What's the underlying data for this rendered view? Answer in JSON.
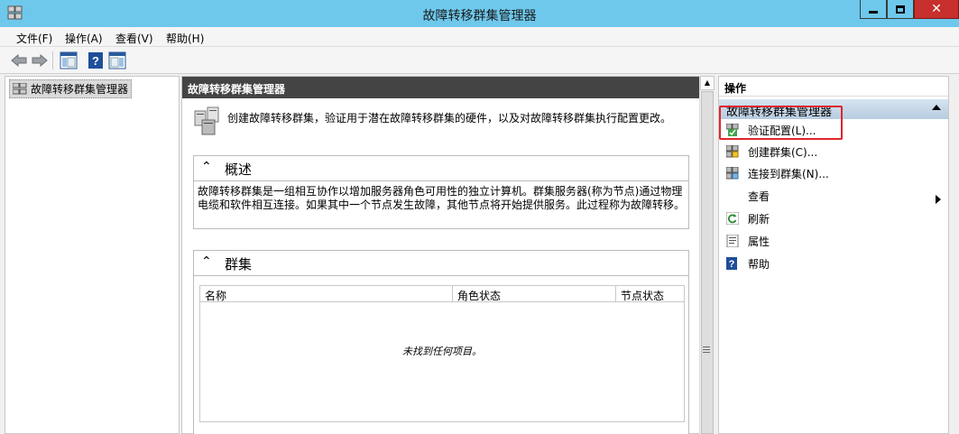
{
  "window": {
    "title": "故障转移群集管理器"
  },
  "menu": [
    {
      "label": "文件(F)"
    },
    {
      "label": "操作(A)"
    },
    {
      "label": "查看(V)"
    },
    {
      "label": "帮助(H)"
    }
  ],
  "tree": {
    "root_label": "故障转移群集管理器"
  },
  "center": {
    "header": "故障转移群集管理器",
    "intro": "创建故障转移群集，验证用于潜在故障转移群集的硬件，以及对故障转移群集执行配置更改。",
    "overview": {
      "title": "概述",
      "text": "故障转移群集是一组相互协作以增加服务器角色可用性的独立计算机。群集服务器(称为节点)通过物理电缆和软件相互连接。如果其中一个节点发生故障，其他节点将开始提供服务。此过程称为故障转移。"
    },
    "clusters": {
      "title": "群集",
      "columns": [
        "名称",
        "角色状态",
        "节点状态"
      ],
      "empty_message": "未找到任何项目。"
    }
  },
  "actions": {
    "title": "操作",
    "group": "故障转移群集管理器",
    "items": [
      {
        "label": "验证配置(L)...",
        "icon": "validate-icon"
      },
      {
        "label": "创建群集(C)...",
        "icon": "create-cluster-icon"
      },
      {
        "label": "连接到群集(N)...",
        "icon": "connect-cluster-icon"
      },
      {
        "label": "查看",
        "icon": "none"
      },
      {
        "label": "刷新",
        "icon": "refresh-icon"
      },
      {
        "label": "属性",
        "icon": "properties-icon"
      },
      {
        "label": "帮助",
        "icon": "help-icon"
      }
    ]
  },
  "colors": {
    "titlebar": "#6ec8ec",
    "close_button": "#c7302c",
    "center_header": "#444444",
    "actions_group": "#c6d8ea",
    "highlight": "#e0262b"
  }
}
